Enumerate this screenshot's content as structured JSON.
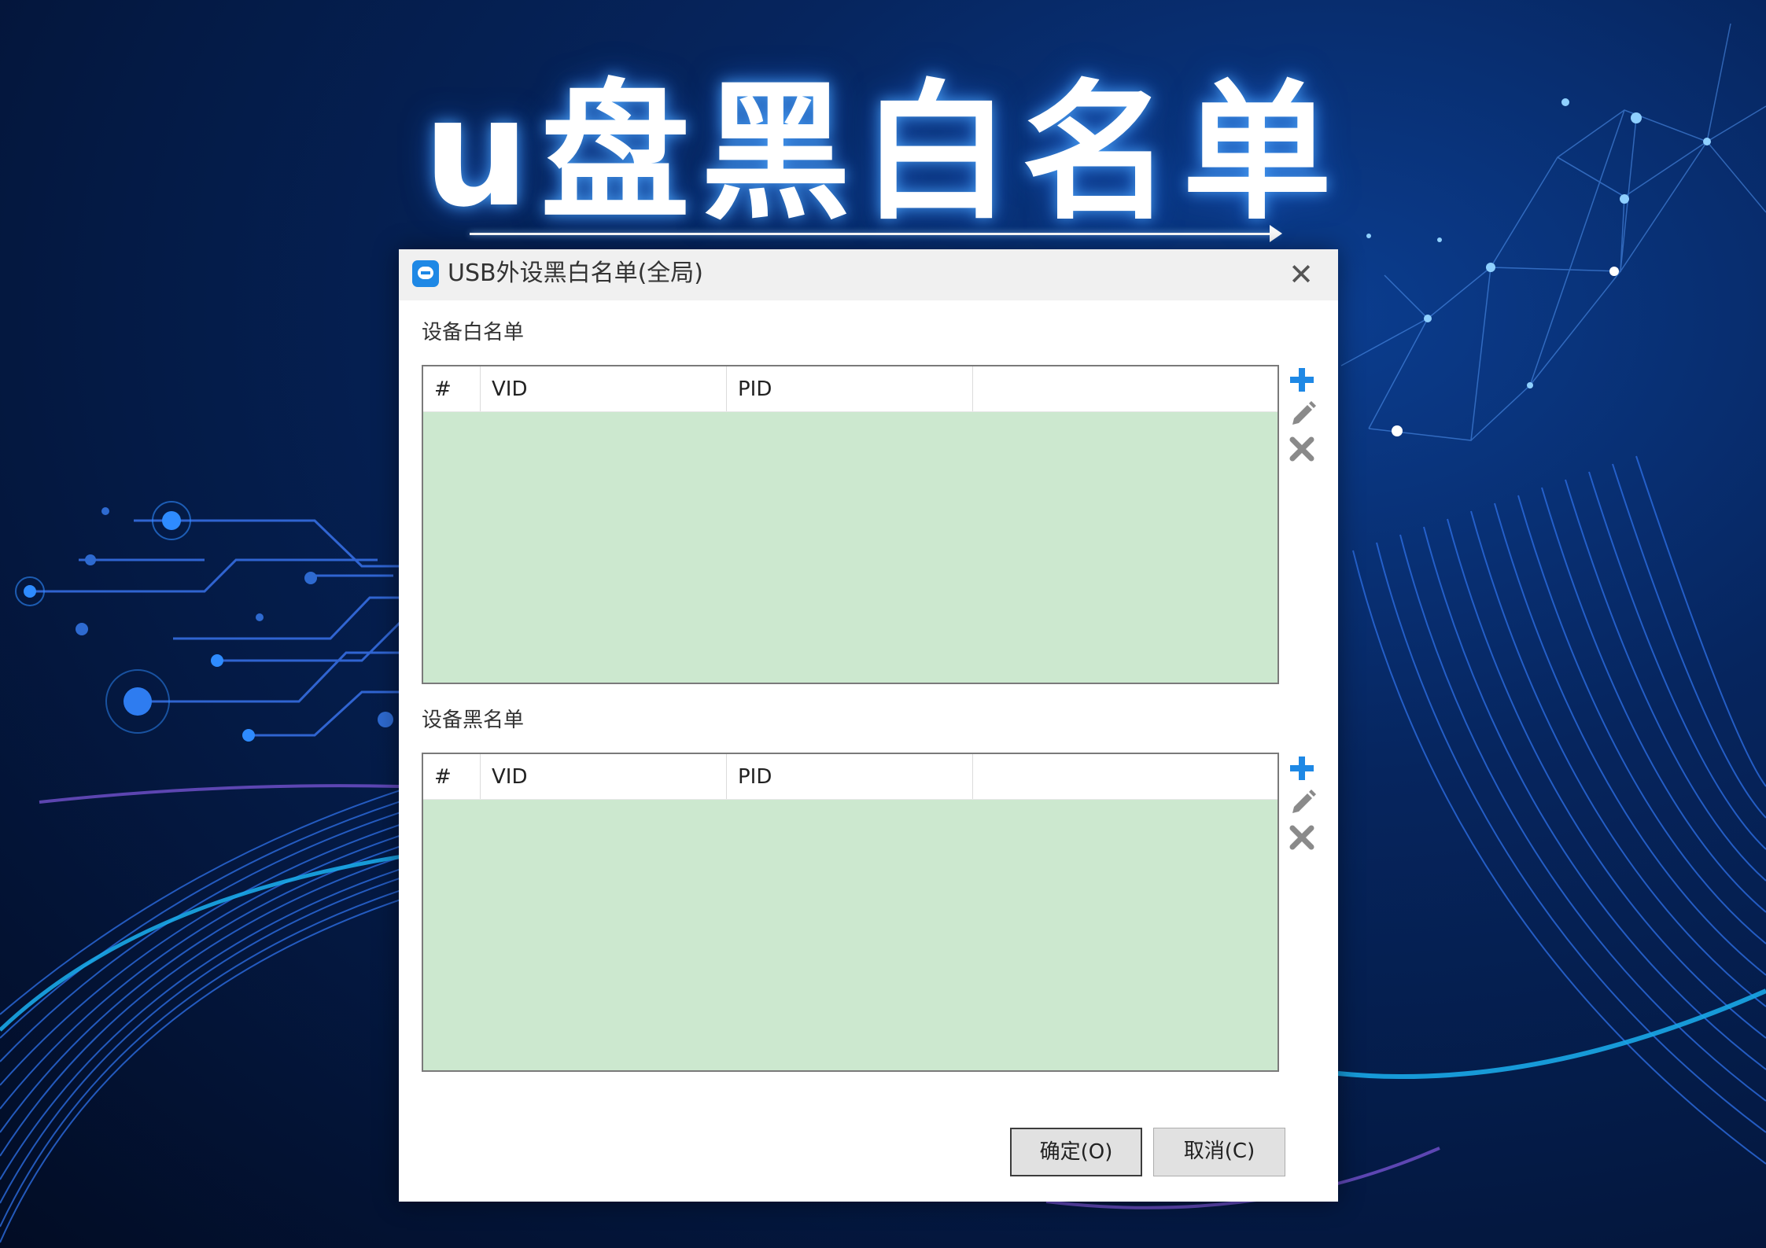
{
  "headline": "u盘黑白名单",
  "dialog": {
    "title": "USB外设黑白名单(全局)",
    "close_glyph": "✕",
    "whitelist": {
      "label": "设备白名单",
      "columns": [
        "#",
        "VID",
        "PID",
        ""
      ],
      "rows": []
    },
    "blacklist": {
      "label": "设备黑名单",
      "columns": [
        "#",
        "VID",
        "PID",
        ""
      ],
      "rows": []
    },
    "ok_label": "确定(O)",
    "cancel_label": "取消(C)"
  },
  "icons": {
    "app": "teamviewer-style-app-icon",
    "add": "plus-icon",
    "edit": "pencil-icon",
    "delete": "x-icon"
  },
  "colors": {
    "table_body": "#cce8cf",
    "add_icon": "#1e88e5",
    "muted_icon": "#8a8a8a",
    "dialog_bg": "#ffffff",
    "titlebar_bg": "#f0f0f0"
  }
}
